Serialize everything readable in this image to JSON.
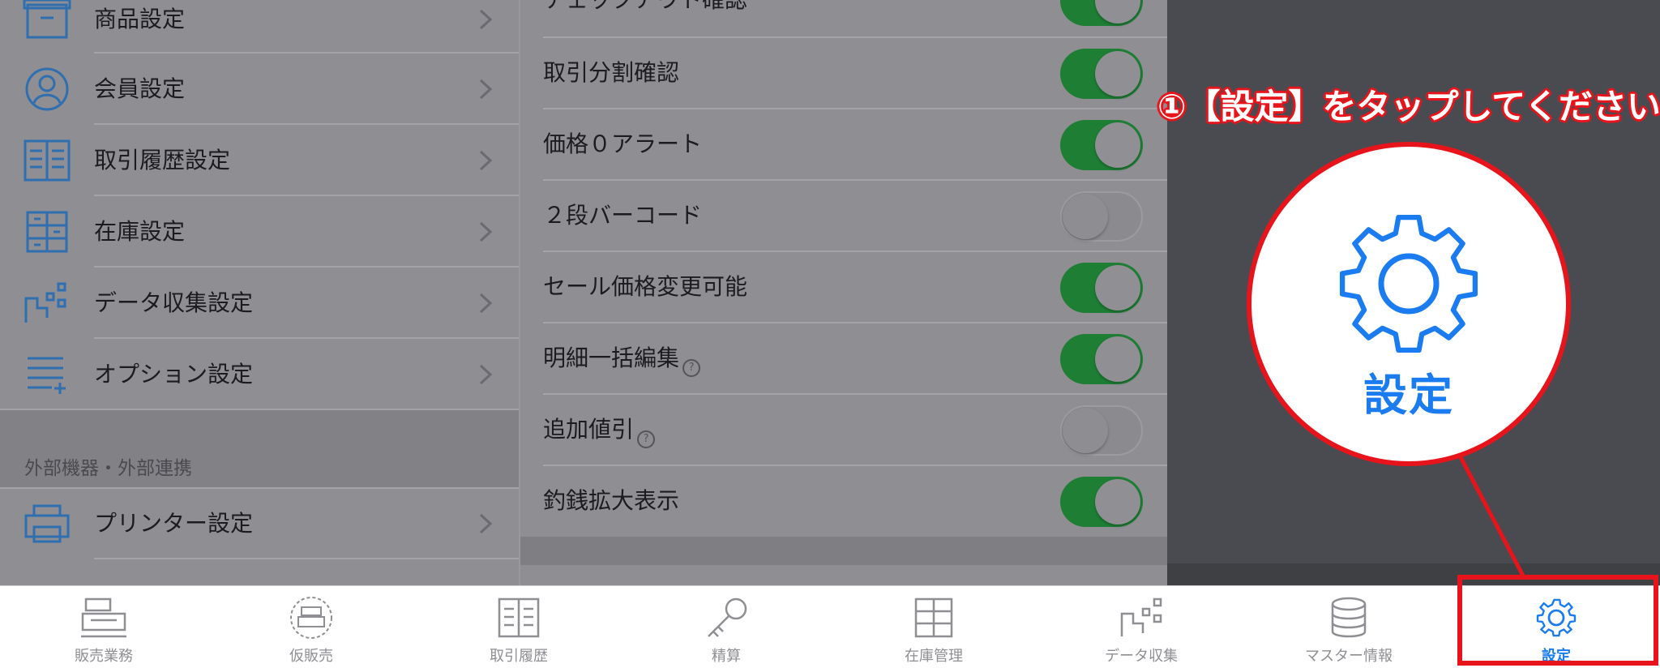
{
  "left_list": {
    "items": [
      {
        "label": "商品設定",
        "icon": "box-icon"
      },
      {
        "label": "会員設定",
        "icon": "person-icon"
      },
      {
        "label": "取引履歴設定",
        "icon": "ledger-icon"
      },
      {
        "label": "在庫設定",
        "icon": "cabinet-icon"
      },
      {
        "label": "データ収集設定",
        "icon": "data-collection-icon"
      },
      {
        "label": "オプション設定",
        "icon": "list-add-icon"
      }
    ],
    "section_title": "外部機器・外部連携",
    "section_items": [
      {
        "label": "プリンター設定",
        "icon": "printer-icon"
      }
    ]
  },
  "option_list": {
    "items": [
      {
        "label": "チェックアウト確認",
        "on": true,
        "help": false
      },
      {
        "label": "取引分割確認",
        "on": true,
        "help": false
      },
      {
        "label": "価格０アラート",
        "on": true,
        "help": false
      },
      {
        "label": "２段バーコード",
        "on": false,
        "help": false
      },
      {
        "label": "セール価格変更可能",
        "on": true,
        "help": false
      },
      {
        "label": "明細一括編集",
        "on": true,
        "help": true
      },
      {
        "label": "追加値引",
        "on": false,
        "help": true
      },
      {
        "label": "釣銭拡大表示",
        "on": true,
        "help": false
      }
    ],
    "help_glyph": "?"
  },
  "tabbar": {
    "tabs": [
      {
        "label": "販売業務",
        "icon": "register-icon"
      },
      {
        "label": "仮販売",
        "icon": "temp-register-icon"
      },
      {
        "label": "取引履歴",
        "icon": "ledger-icon"
      },
      {
        "label": "精算",
        "icon": "key-icon"
      },
      {
        "label": "在庫管理",
        "icon": "cabinet-icon"
      },
      {
        "label": "データ収集",
        "icon": "data-collection-icon"
      },
      {
        "label": "マスター情報",
        "icon": "database-icon"
      },
      {
        "label": "設定",
        "icon": "gear-icon",
        "active": true
      }
    ]
  },
  "annotation": {
    "instruction": "①【設定】をタップしてください",
    "zoom_label": "設定"
  },
  "colors": {
    "accent": "#1a7cf0",
    "toggle_on": "#1e7e34",
    "annotation_red": "#e8141b",
    "icon_blue": "#2f6fb0"
  }
}
